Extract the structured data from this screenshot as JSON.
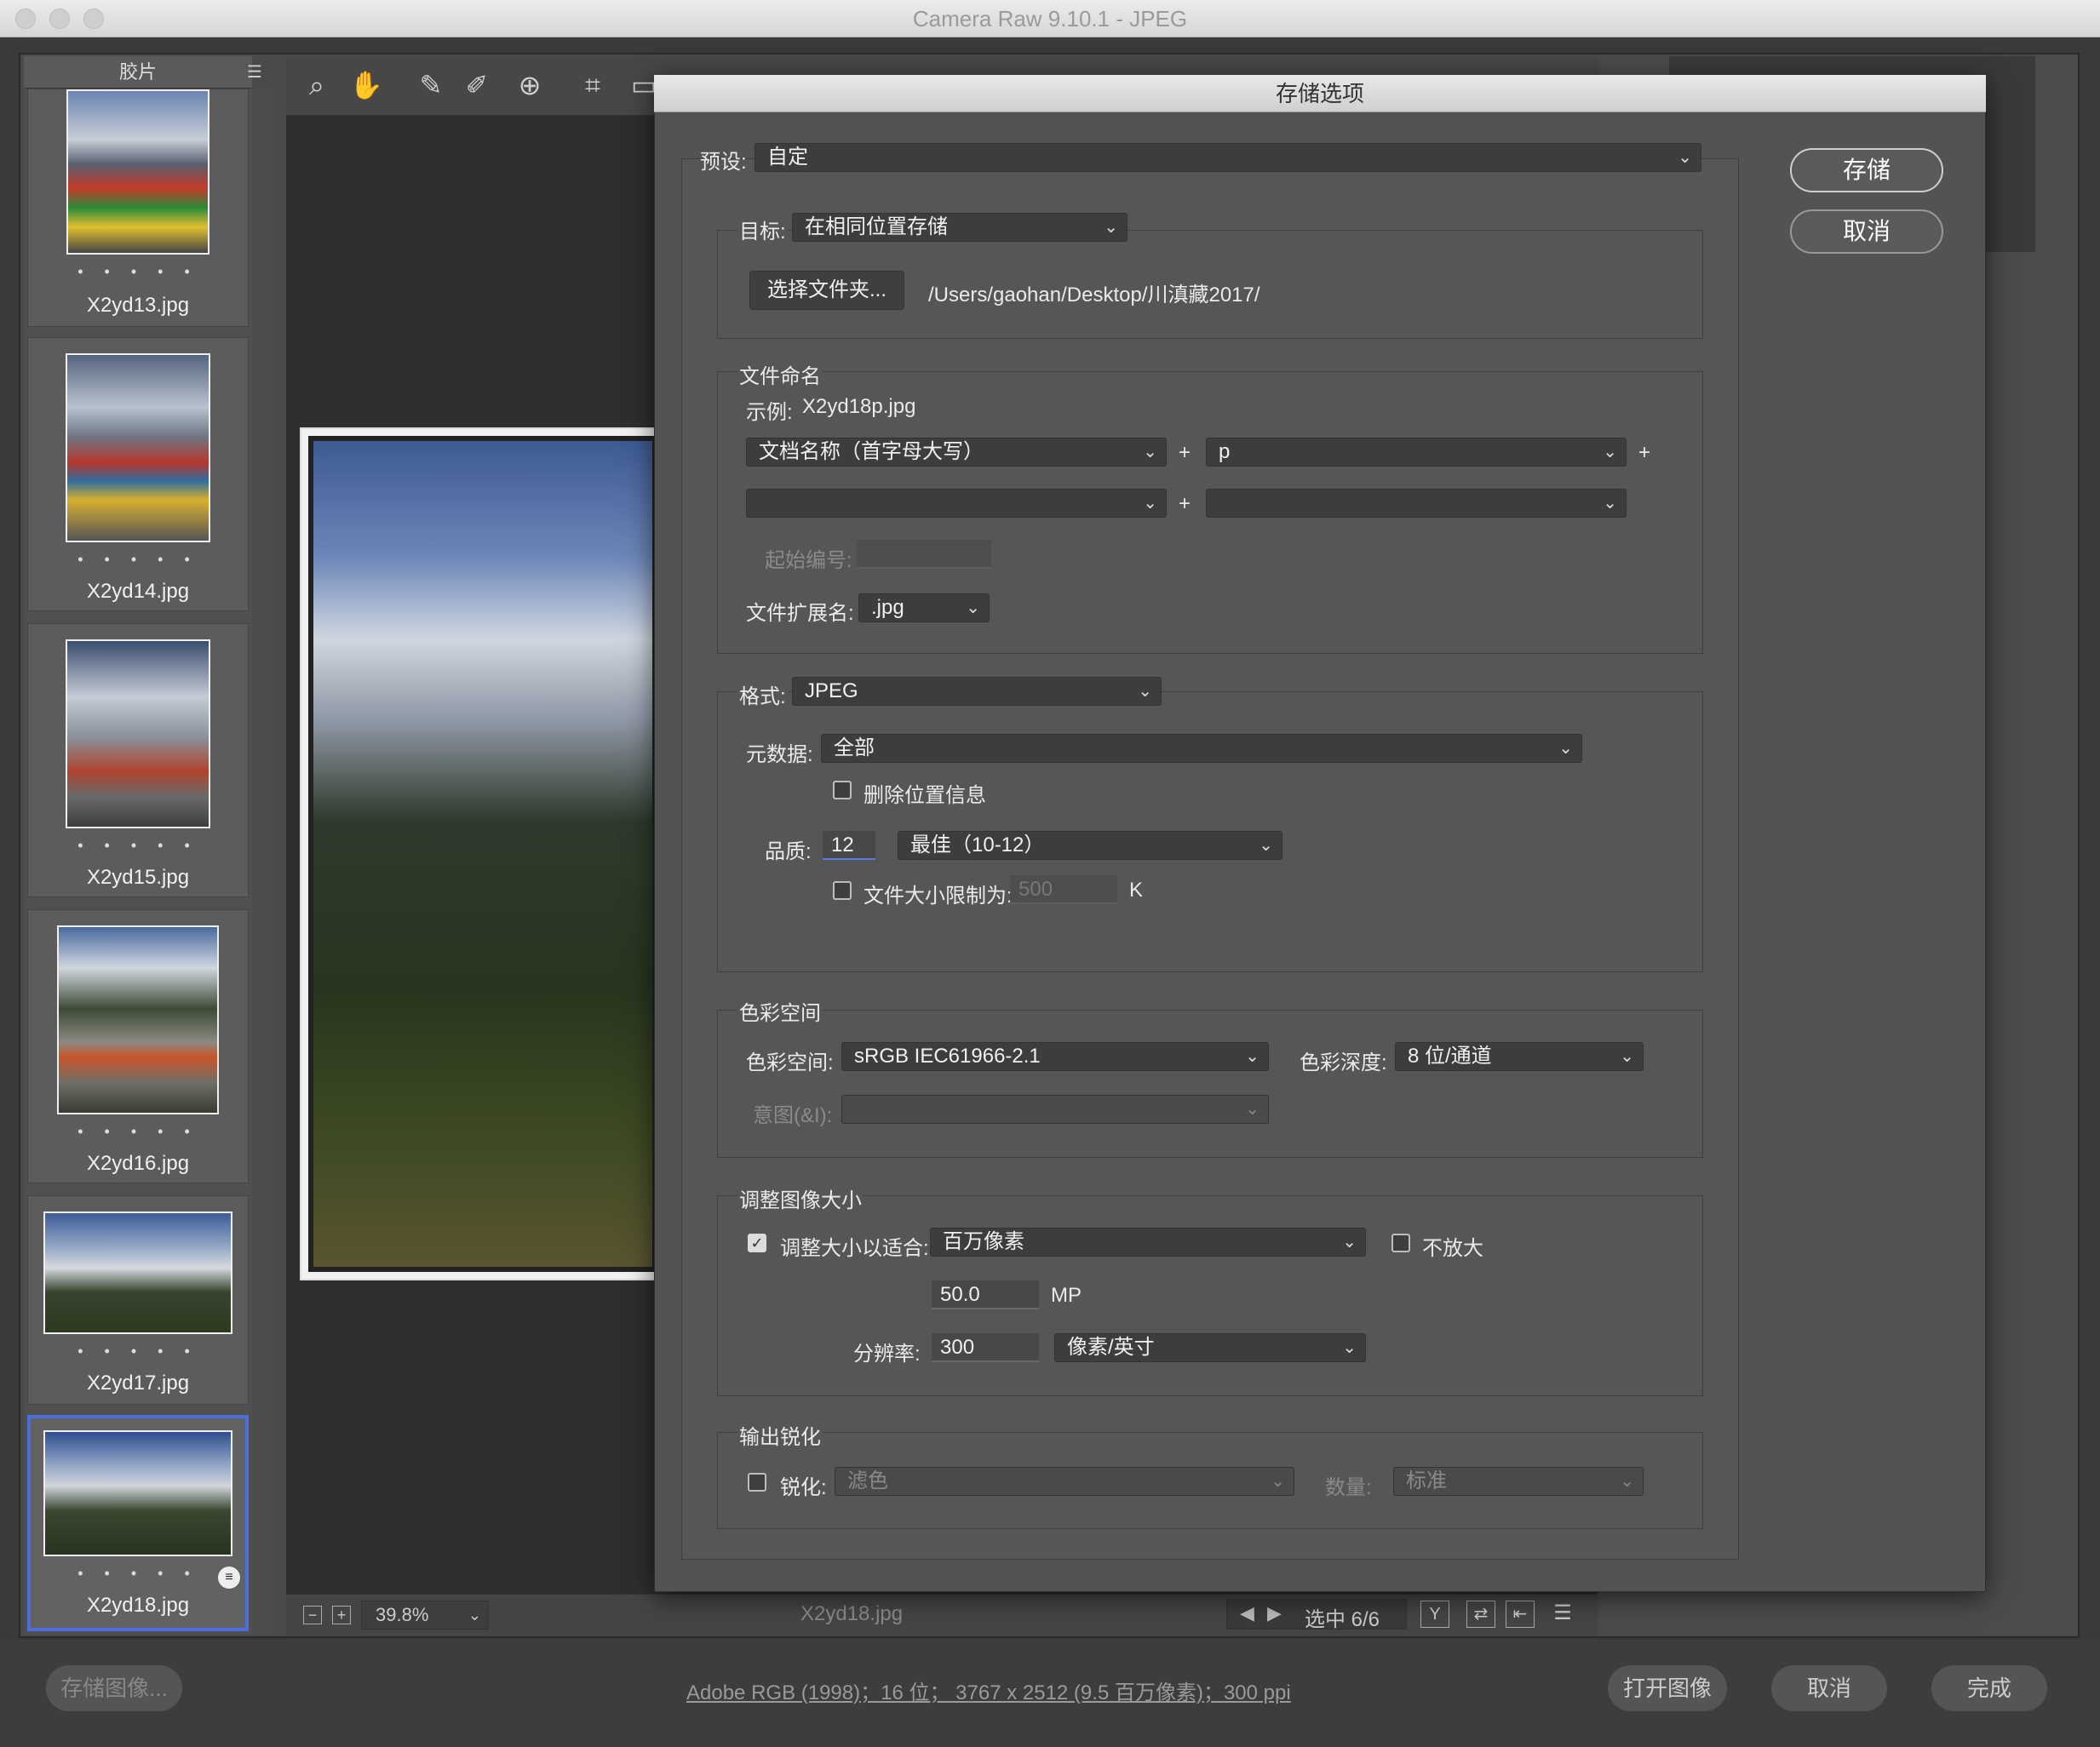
{
  "window": {
    "title": "Camera Raw 9.10.1 -  JPEG"
  },
  "filmstrip": {
    "header": "胶片",
    "rating_dots": "• • • • •",
    "items": [
      {
        "name": "X2yd13.jpg"
      },
      {
        "name": "X2yd14.jpg"
      },
      {
        "name": "X2yd15.jpg"
      },
      {
        "name": "X2yd16.jpg"
      },
      {
        "name": "X2yd17.jpg"
      },
      {
        "name": "X2yd18.jpg",
        "selected": true
      }
    ]
  },
  "statusbar": {
    "zoom": "39.8%",
    "filename": "X2yd18.jpg",
    "selection": "选中 6/6"
  },
  "footer": {
    "save_image": "存储图像...",
    "workflow_link": "Adobe RGB (1998)；16 位；  3767 x 2512 (9.5 百万像素)；300 ppi",
    "open_image": "打开图像",
    "cancel": "取消",
    "done": "完成"
  },
  "dialog": {
    "title": "存储选项",
    "save_button": "存储",
    "cancel_button": "取消",
    "preset": {
      "label": "预设:",
      "value": "自定"
    },
    "destination": {
      "label": "目标:",
      "value": "在相同位置存储",
      "choose_folder": "选择文件夹...",
      "path": "/Users/gaohan/Desktop/川滇藏2017/"
    },
    "file_naming": {
      "title": "文件命名",
      "example_label": "示例:",
      "example_value": "X2yd18p.jpg",
      "field1": "文档名称（首字母大写）",
      "field2": "p",
      "field3": "",
      "field4": "",
      "plus": "+",
      "start_number_label": "起始编号:",
      "extension_label": "文件扩展名:",
      "extension_value": ".jpg"
    },
    "format": {
      "label": "格式:",
      "value": "JPEG",
      "metadata_label": "元数据:",
      "metadata_value": "全部",
      "remove_location": "删除位置信息",
      "quality_label": "品质:",
      "quality_value": "12",
      "quality_preset": "最佳（10-12）",
      "limit_label": "文件大小限制为:",
      "limit_value": "500",
      "limit_unit": "K"
    },
    "color_space": {
      "title": "色彩空间",
      "space_label": "色彩空间:",
      "space_value": "sRGB IEC61966-2.1",
      "depth_label": "色彩深度:",
      "depth_value": "8 位/通道",
      "intent_label": "意图(&I):",
      "intent_value": ""
    },
    "resize": {
      "title": "调整图像大小",
      "fit_label": "调整大小以适合:",
      "fit_value": "百万像素",
      "no_enlarge": "不放大",
      "mp_value": "50.0",
      "mp_unit": "MP",
      "resolution_label": "分辨率:",
      "resolution_value": "300",
      "resolution_unit": "像素/英寸"
    },
    "sharpen": {
      "title": "输出锐化",
      "sharpen_label": "锐化:",
      "sharpen_value": "滤色",
      "amount_label": "数量:",
      "amount_value": "标准"
    }
  },
  "colors": {
    "accent": "#4a6ee0",
    "dialog_bg": "#535353",
    "app_bg": "#3a3a3a"
  }
}
